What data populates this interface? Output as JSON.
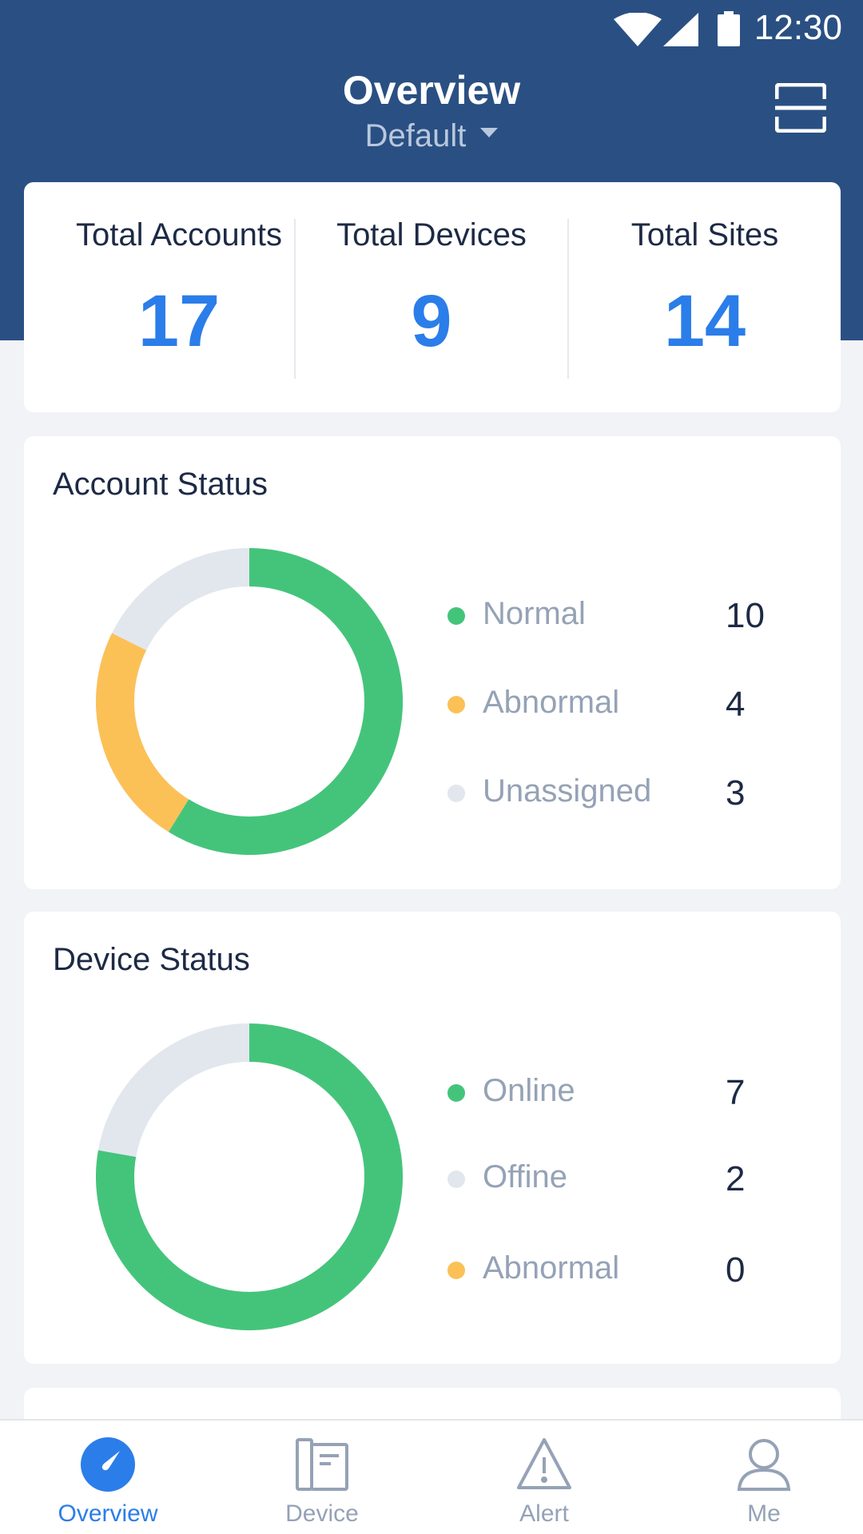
{
  "status_bar": {
    "time": "12:30",
    "icons": [
      "wifi-icon",
      "signal-icon",
      "battery-icon"
    ]
  },
  "header": {
    "title": "Overview",
    "site": "Default",
    "scan_icon": "scan-icon"
  },
  "summary": [
    {
      "label": "Total Accounts",
      "value": "17"
    },
    {
      "label": "Total Devices",
      "value": "9"
    },
    {
      "label": "Total Sites",
      "value": "14"
    }
  ],
  "account_status": {
    "title": "Account Status",
    "items": [
      {
        "label": "Normal",
        "value": "10",
        "color": "#44c47b"
      },
      {
        "label": "Abnormal",
        "value": "4",
        "color": "#fbc157"
      },
      {
        "label": "Unassigned",
        "value": "3",
        "color": "#e2e7ee"
      }
    ]
  },
  "device_status": {
    "title": "Device Status",
    "items": [
      {
        "label": "Online",
        "value": "7",
        "color": "#44c47b"
      },
      {
        "label": "Offine",
        "value": "2",
        "color": "#e2e7ee"
      },
      {
        "label": "Abnormal",
        "value": "0",
        "color": "#fbc157"
      }
    ]
  },
  "nav": [
    {
      "label": "Overview",
      "icon": "dashboard-icon",
      "active": true
    },
    {
      "label": "Device",
      "icon": "device-icon",
      "active": false
    },
    {
      "label": "Alert",
      "icon": "alert-icon",
      "active": false
    },
    {
      "label": "Me",
      "icon": "user-icon",
      "active": false
    }
  ],
  "colors": {
    "header": "#2a5083",
    "accent": "#2b7de9",
    "inactive": "#95a2b6"
  }
}
